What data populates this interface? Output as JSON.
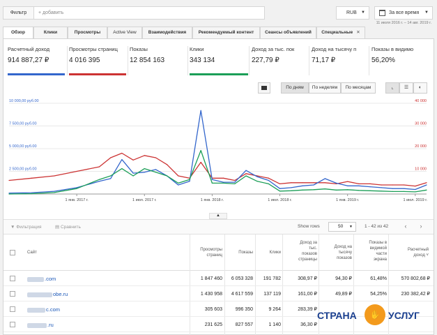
{
  "topbar": {
    "filter_label": "Фильтр",
    "filter_add_placeholder": "+ добавить",
    "currency": "RUB",
    "date_button": "За все время",
    "date_range": "11 июля 2016 г. – 14 авг. 2019 г."
  },
  "tabs": [
    {
      "label": "Обзор"
    },
    {
      "label": "Клики"
    },
    {
      "label": "Просмотры"
    },
    {
      "label": "Active View"
    },
    {
      "label": "Взаимодействия"
    },
    {
      "label": "Рекомендуемый контент"
    },
    {
      "label": "Сеансы объявлений"
    },
    {
      "label": "Специальные"
    }
  ],
  "tab_close": "✕",
  "metrics": [
    {
      "label": "Расчетный доход",
      "value": "914 887,27 ₽",
      "color": "#3366cc"
    },
    {
      "label": "Просмотры страниц",
      "value": "4 016 395",
      "color": "#cc3333"
    },
    {
      "label": "Показы",
      "value": "12 854 163",
      "color": ""
    },
    {
      "label": "Клики",
      "value": "343 134",
      "color": "#1b9e57"
    },
    {
      "label": "Доход за тыс. пок",
      "value": "227,79 ₽",
      "color": ""
    },
    {
      "label": "Доход на тысячу п",
      "value": "71,17 ₽",
      "color": ""
    },
    {
      "label": "Показы в видимо",
      "value": "56,20%",
      "color": ""
    }
  ],
  "chart_controls": {
    "by_day": "По дням",
    "by_week": "По неделям",
    "by_month": "По месяцам",
    "chart_type_icons": [
      "line-chart-icon",
      "bar-chart-icon",
      "pie-chart-icon"
    ]
  },
  "collapse_arrow": "▲",
  "chart_data": {
    "type": "line",
    "left_axis": {
      "ticks": [
        "10 000,00 руб.00",
        "7 500,00 руб.00",
        "5 000,00 руб.00",
        "2 500,00 руб.00"
      ],
      "values": [
        10000,
        7500,
        5000,
        2500
      ],
      "ylim": [
        0,
        10000
      ],
      "color": "#3366cc"
    },
    "right_axis": {
      "ticks": [
        "40 000",
        "30 000",
        "20 000",
        "10 000"
      ],
      "values": [
        40000,
        30000,
        20000,
        10000
      ],
      "ylim": [
        0,
        40000
      ],
      "color": "#cc3333"
    },
    "x_ticks": [
      "1 янв. 2017 г.",
      "1 июл. 2017 г.",
      "1 янв. 2018 г.",
      "1 июл. 2018 г.",
      "1 янв. 2019 г.",
      "1 июл. 2019 г."
    ],
    "x": [
      "2016-07",
      "2016-09",
      "2016-11",
      "2017-01",
      "2017-03",
      "2017-04",
      "2017-05",
      "2017-06",
      "2017-07",
      "2017-08",
      "2017-09",
      "2017-10",
      "2017-11",
      "2017-12",
      "2018-01",
      "2018-02",
      "2018-03",
      "2018-04",
      "2018-05",
      "2018-06",
      "2018-07",
      "2018-08",
      "2018-09",
      "2018-10",
      "2018-11",
      "2018-12",
      "2019-01",
      "2019-02",
      "2019-03",
      "2019-04",
      "2019-05",
      "2019-06",
      "2019-07",
      "2019-08"
    ],
    "series": [
      {
        "values": [
          100,
          150,
          300,
          700,
          1400,
          1700,
          3800,
          2300,
          2400,
          2700,
          2000,
          1000,
          1400,
          9200,
          1600,
          1300,
          1300,
          2600,
          1900,
          1500,
          600,
          700,
          900,
          1000,
          1700,
          1200,
          900,
          900,
          800,
          700,
          600,
          600,
          500,
          1000
        ],
        "color": "#3366cc"
      },
      {
        "values": [
          6000,
          7000,
          8000,
          10000,
          12000,
          16000,
          18000,
          15000,
          17000,
          16000,
          13000,
          8000,
          7000,
          14000,
          7000,
          7000,
          6000,
          9000,
          8000,
          7000,
          4500,
          5000,
          5000,
          5000,
          5000,
          4500,
          5500,
          4500,
          4500,
          4000,
          4000,
          4000,
          3500,
          5000
        ],
        "color": "#cc3333"
      },
      {
        "values": [
          0,
          10,
          40,
          150,
          400,
          500,
          700,
          500,
          700,
          600,
          500,
          300,
          400,
          1200,
          300,
          300,
          280,
          500,
          350,
          280,
          80,
          90,
          110,
          120,
          140,
          110,
          120,
          100,
          90,
          80,
          70,
          70,
          60,
          110
        ],
        "color": "#1b9e57"
      }
    ]
  },
  "table_toolbar": {
    "filter": "Фильтрация",
    "compare": "Сравнить",
    "show_rows_label": "Show rows",
    "rows_value": "50",
    "page_info": "1 - 42 из 42",
    "prev": "‹",
    "next": "›"
  },
  "table": {
    "headers": {
      "site": "Сайт",
      "pageviews": [
        "Просмотры",
        "страниц"
      ],
      "impressions": [
        "Показы"
      ],
      "clicks": [
        "Клики"
      ],
      "rpm_page": [
        "Доход за",
        "тыс.",
        "показов",
        "страницы"
      ],
      "rpm_imp": [
        "Доход на",
        "тысячу",
        "показов"
      ],
      "viewable": [
        "Показы в",
        "видимой",
        "части",
        "экрана"
      ],
      "revenue": [
        "Расчетный",
        "доход ˅"
      ]
    },
    "rows": [
      {
        "site": ".com",
        "pageviews": "1 847 460",
        "impressions": "6 053 328",
        "clicks": "191 782",
        "rpm_page": "308,97 ₽",
        "rpm_imp": "94,30 ₽",
        "viewable": "61,48%",
        "revenue": "570 802,68 ₽"
      },
      {
        "site": "obe.ru",
        "pageviews": "1 430 958",
        "impressions": "4 617 559",
        "clicks": "137 119",
        "rpm_page": "161,00 ₽",
        "rpm_imp": "49,89 ₽",
        "viewable": "54,25%",
        "revenue": "230 382,42 ₽"
      },
      {
        "site": "c.com",
        "pageviews": "305 603",
        "impressions": "996 350",
        "clicks": "9 264",
        "rpm_page": "283,39 ₽",
        "rpm_imp": "",
        "viewable": "",
        "revenue": ""
      },
      {
        "site": ".ru",
        "pageviews": "231 625",
        "impressions": "827 557",
        "clicks": "1 140",
        "rpm_page": "36,30 ₽",
        "rpm_imp": "",
        "viewable": "",
        "revenue": ""
      }
    ]
  },
  "watermark": {
    "left": "СТРАНА",
    "right": "УСЛУГ"
  }
}
